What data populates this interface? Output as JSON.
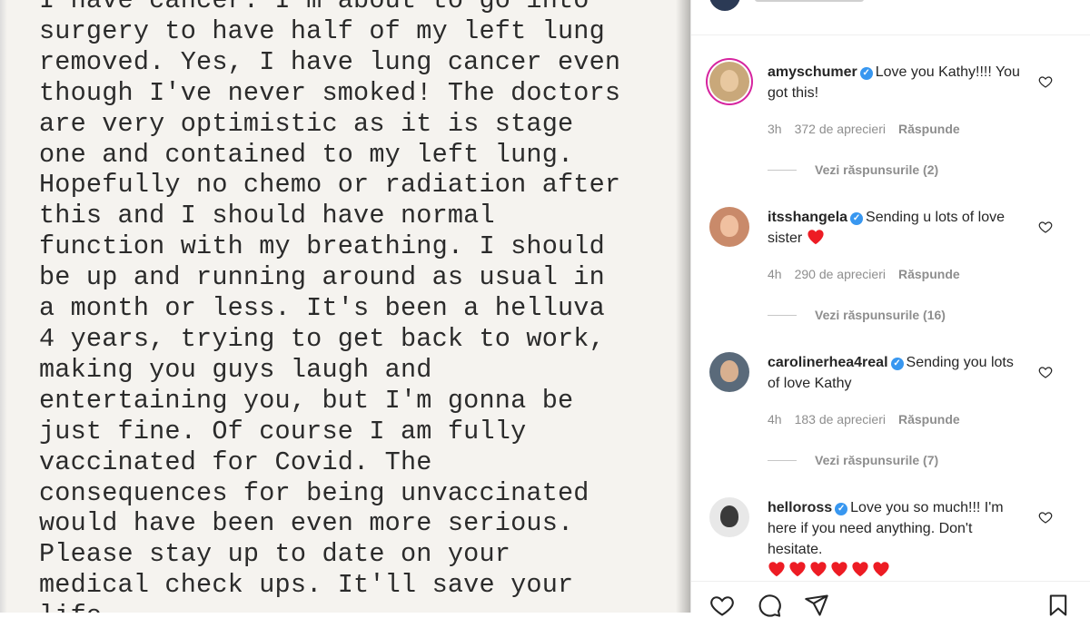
{
  "post": {
    "note_lines": [
      "I have cancer. I'm about to go into",
      "surgery to have half of my left lung",
      "removed. Yes, I have lung cancer even",
      "though I've never smoked! The doctors",
      "are very optimistic as it is stage",
      "one and contained to my left lung.",
      "Hopefully no chemo or radiation after",
      "this and I should have normal",
      "function with my breathing. I should",
      "be up and running around as usual in",
      "a month or less. It's been a helluva",
      "4 years, trying to get back to work,",
      "making you guys laugh and",
      "entertaining you, but I'm gonna be",
      "just fine. Of course I am fully",
      "vaccinated for Covid. The",
      "consequences for being unvaccinated",
      "would have been even more serious.",
      "Please stay up to date on your",
      "medical check ups. It'll save your",
      "life."
    ]
  },
  "comments": [
    {
      "username": "amyschumer",
      "text": "Love you Kathy!!!! You got this!",
      "time": "3h",
      "likes": "372 de aprecieri",
      "reply": "Răspunde",
      "view_replies": "Vezi răspunsurile (2)",
      "hearts": 0,
      "avatar_bg": "#c9a87a",
      "face": "#e8c8a0"
    },
    {
      "username": "itsshangela",
      "text": "Sending u lots of love sister",
      "time": "4h",
      "likes": "290 de aprecieri",
      "reply": "Răspunde",
      "view_replies": "Vezi răspunsurile (16)",
      "hearts": 1,
      "avatar_bg": "#c98a6a",
      "face": "#f0c0a0"
    },
    {
      "username": "carolinerhea4real",
      "text": "Sending you lots of love Kathy",
      "time": "4h",
      "likes": "183 de aprecieri",
      "reply": "Răspunde",
      "view_replies": "Vezi răspunsurile (7)",
      "hearts": 0,
      "avatar_bg": "#5a6a7a",
      "face": "#d8b090"
    },
    {
      "username": "helloross",
      "text": "Love you so much!!! I'm here if you need anything. Don't hesitate.",
      "time": "",
      "likes": "",
      "reply": "",
      "view_replies": "",
      "hearts": 6,
      "avatar_bg": "#e8e8e8",
      "face": "#3a3a3a"
    }
  ],
  "icons": {
    "verified": "verified-badge-icon",
    "like": "heart-outline-icon",
    "emoji_heart": "red-heart-emoji",
    "actions": [
      "heart-outline-icon",
      "comment-bubble-icon",
      "share-paper-plane-icon",
      "bookmark-icon"
    ]
  },
  "colors": {
    "verified": "#3897f0",
    "muted": "#8e8e8e",
    "text": "#262626",
    "heart": "#ed1c24"
  }
}
